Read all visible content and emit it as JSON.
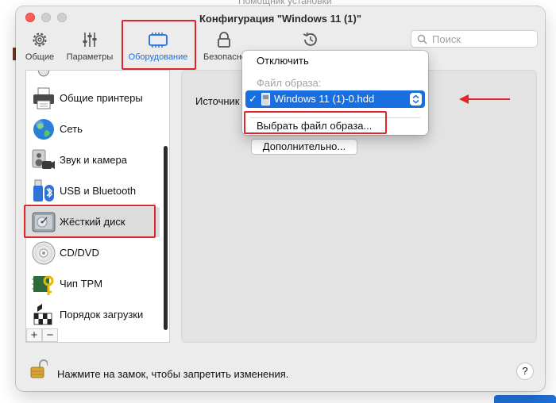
{
  "background": {
    "top_text": "Помощник установки"
  },
  "window": {
    "title": "Конфигурация \"Windows 11 (1)\""
  },
  "toolbar": {
    "items": [
      {
        "label": "Общие",
        "icon": "gear-icon"
      },
      {
        "label": "Параметры",
        "icon": "sliders-icon"
      },
      {
        "label": "Оборудование",
        "icon": "hardware-icon",
        "selected": true
      },
      {
        "label": "Безопасность",
        "icon": "lock-icon"
      },
      {
        "label": "",
        "icon": "history-icon"
      }
    ],
    "search_placeholder": "Поиск"
  },
  "sidebar": {
    "items": [
      {
        "label": "Общие принтеры",
        "icon": "printer-icon"
      },
      {
        "label": "Сеть",
        "icon": "globe-icon"
      },
      {
        "label": "Звук и камера",
        "icon": "speaker-camera-icon"
      },
      {
        "label": "USB и Bluetooth",
        "icon": "usb-bluetooth-icon"
      },
      {
        "label": "Жёсткий диск",
        "icon": "hard-disk-icon",
        "selected": true
      },
      {
        "label": "CD/DVD",
        "icon": "cd-dvd-icon"
      },
      {
        "label": "Чип TPM",
        "icon": "tpm-chip-icon"
      },
      {
        "label": "Порядок загрузки",
        "icon": "boot-order-icon"
      }
    ],
    "add_label": "+",
    "remove_label": "−"
  },
  "content": {
    "source_label": "Источник",
    "advanced_button": "Дополнительно..."
  },
  "dropdown": {
    "disconnect": "Отключить",
    "image_file_header": "Файл образа:",
    "selected_file": "Windows 11 (1)-0.hdd",
    "choose_image": "Выбрать файл образа..."
  },
  "footer": {
    "lock_text": "Нажмите на замок, чтобы запретить изменения.",
    "help": "?"
  },
  "colors": {
    "accent": "#1a6fe0",
    "annotation": "#e0262a"
  }
}
